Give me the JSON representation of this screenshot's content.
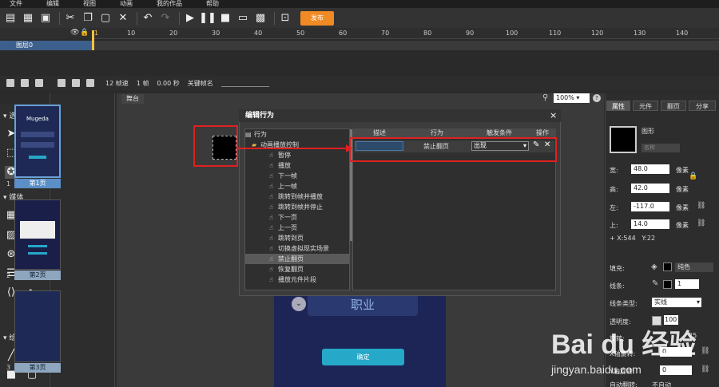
{
  "menu": [
    "文件",
    "编辑",
    "视图",
    "动画",
    "我的作品",
    "帮助"
  ],
  "toolbar": {
    "publish_label": "发布"
  },
  "ruler": [
    "1",
    "10",
    "20",
    "30",
    "40",
    "50",
    "60",
    "70",
    "80",
    "90",
    "100",
    "110",
    "120",
    "130",
    "140"
  ],
  "timeline": {
    "layer_name": "图层0",
    "fps": "12 帧速",
    "frame": "1 帧",
    "time": "0.00 秒",
    "keyframe_label": "关键帧名"
  },
  "left_tools": {
    "select_section": "选择",
    "media_section": "媒体",
    "draw_section": "绘制"
  },
  "pages": [
    {
      "num": "1",
      "label": "第1页",
      "app_name": "Mugeda"
    },
    {
      "num": "2",
      "label": "第2页"
    },
    {
      "num": "3",
      "label": "第3页"
    }
  ],
  "stage": {
    "tab": "舞台",
    "zoom": "100%",
    "help": "?",
    "job_text": "职业",
    "confirm_text": "确定"
  },
  "dialog": {
    "title": "编辑行为",
    "close": "×",
    "tree_root": "行为",
    "tree_group": "动画播放控制",
    "tree_items": [
      "暂停",
      "播放",
      "下一帧",
      "上一帧",
      "跳转到帧并播放",
      "跳转到帧并停止",
      "下一页",
      "上一页",
      "跳转到页",
      "切换虚拟现实场景",
      "禁止翻页",
      "恢复翻页",
      "播放元件片段"
    ],
    "selected_item": "禁止翻页",
    "columns": {
      "desc": "描述",
      "action": "行为",
      "trigger": "触发条件",
      "op": "操作"
    },
    "row": {
      "action": "禁止翻页",
      "trigger": "出现"
    }
  },
  "right_panel": {
    "tabs": [
      "属性",
      "元件",
      "翻页",
      "分享"
    ],
    "shape_label": "图形",
    "name_placeholder": "名称",
    "width_label": "宽:",
    "width": "48.0",
    "height_label": "高:",
    "height": "42.0",
    "left_label": "左:",
    "left": "-117.0",
    "top_label": "上:",
    "top": "14.0",
    "unit": "像素",
    "coords": "X:544",
    "coords_y": "Y:22",
    "fill_label": "填充:",
    "fill_type": "纯色",
    "stroke_label": "线条:",
    "stroke_width": "1",
    "stroke_type_label": "线条类型:",
    "stroke_type": "实线",
    "opacity_label": "透明度:",
    "opacity": "100",
    "rotate_label": "旋转:",
    "rotate_value": "25",
    "xrot_label": "X轴旋转:",
    "xrot": "0",
    "yrot_label": "Y轴旋转:",
    "yrot": "0",
    "auto_label": "自动翻转:",
    "auto": "不自动"
  },
  "watermark": {
    "big": "Bai du 经验",
    "small": "jingyan.baidu.com"
  }
}
